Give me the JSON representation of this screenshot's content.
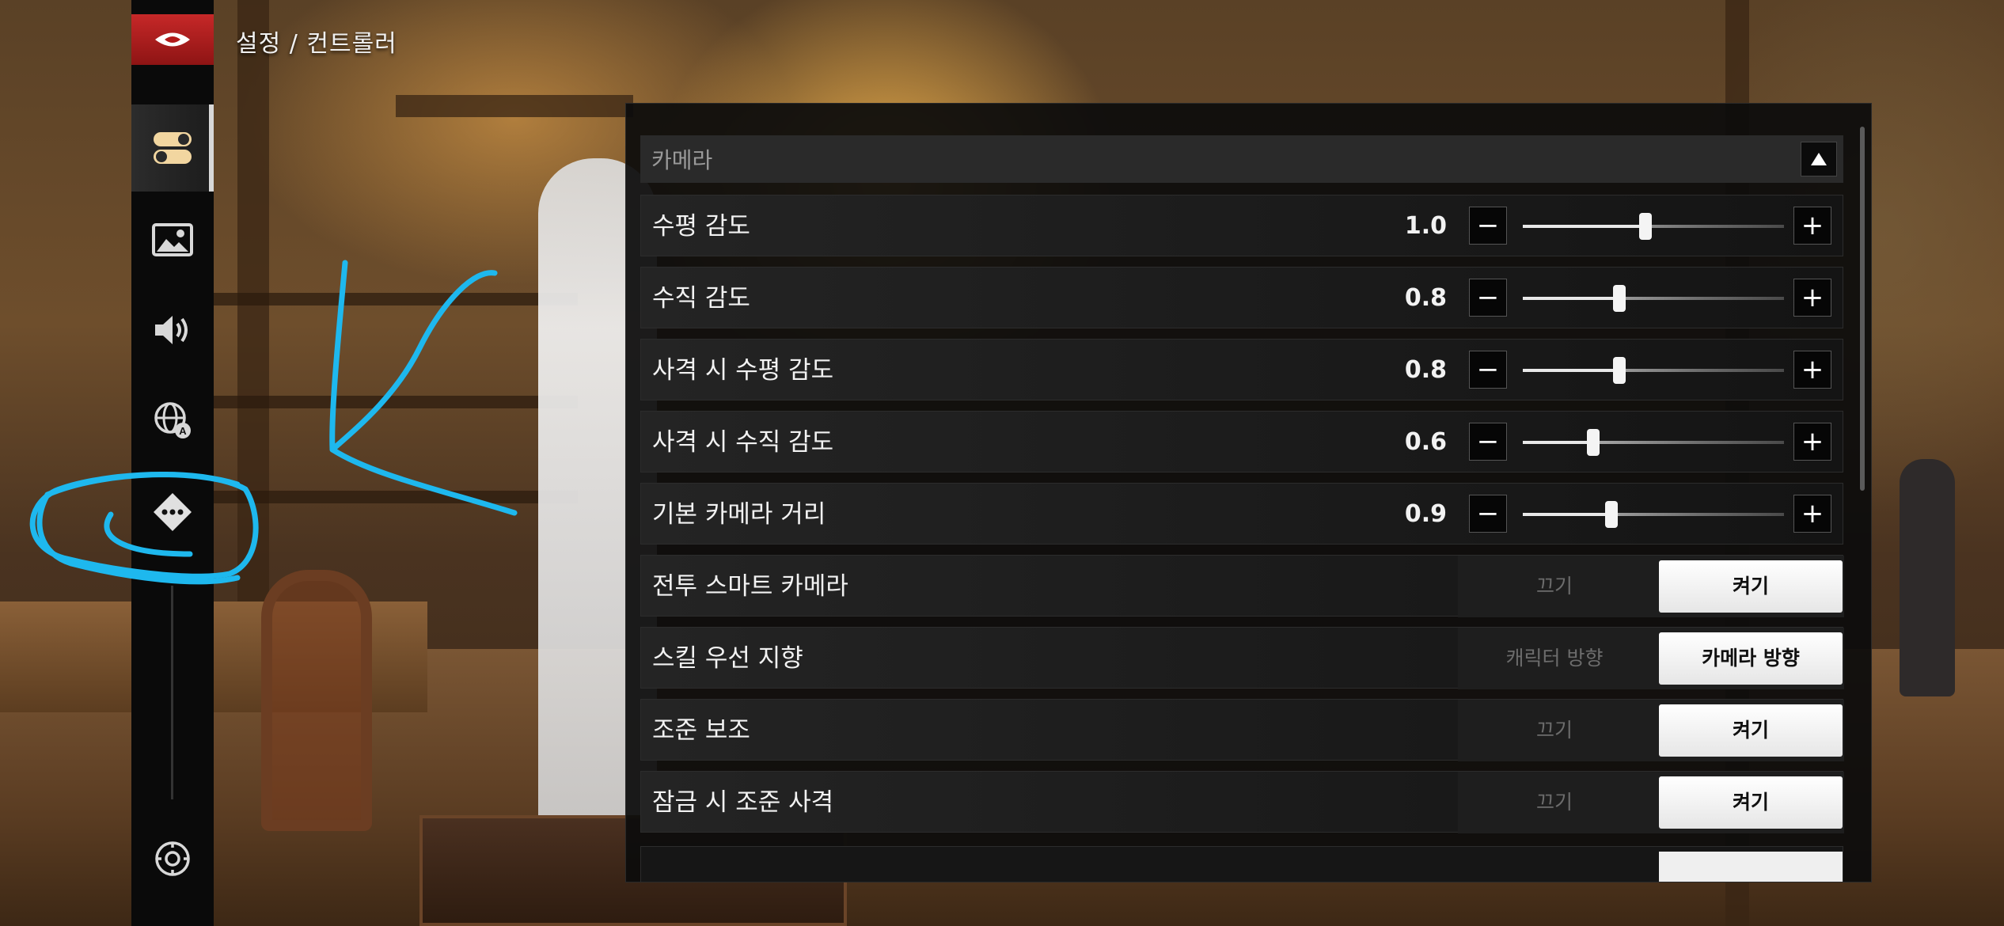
{
  "breadcrumb": "설정 / 컨트롤러",
  "sidebar": {
    "back_icon": "game-logo-back-icon",
    "items": [
      {
        "icon": "toggle-settings-icon",
        "active": true
      },
      {
        "icon": "image-display-icon",
        "active": false
      },
      {
        "icon": "speaker-sound-icon",
        "active": false
      },
      {
        "icon": "globe-language-icon",
        "active": false
      },
      {
        "icon": "dpad-controller-icon",
        "active": false
      }
    ],
    "bottom_icon": "reset-gear-icon"
  },
  "section": {
    "title": "카메라",
    "collapse_icon": "triangle-up-icon"
  },
  "sliders": [
    {
      "label": "수평 감도",
      "value": "1.0",
      "level": 0.47
    },
    {
      "label": "수직 감도",
      "value": "0.8",
      "level": 0.37
    },
    {
      "label": "사격 시 수평 감도",
      "value": "0.8",
      "level": 0.37
    },
    {
      "label": "사격 시 수직 감도",
      "value": "0.6",
      "level": 0.27
    },
    {
      "label": "기본 카메라 거리",
      "value": "0.9",
      "level": 0.34
    }
  ],
  "stepper": {
    "minus": "−",
    "plus": "+"
  },
  "toggles": [
    {
      "label": "전투 스마트 카메라",
      "off": "끄기",
      "on": "켜기",
      "selected": "on"
    },
    {
      "label": "스킬 우선 지향",
      "off": "캐릭터 방향",
      "on": "카메라 방향",
      "selected": "on"
    },
    {
      "label": "조준 보조",
      "off": "끄기",
      "on": "켜기",
      "selected": "on"
    },
    {
      "label": "잠금 시 조준 사격",
      "off": "끄기",
      "on": "켜기",
      "selected": "on"
    }
  ],
  "colors": {
    "accent_red": "#c62828",
    "annotation_blue": "#1eb8ee",
    "panel_bg": "#0c0c0c"
  }
}
